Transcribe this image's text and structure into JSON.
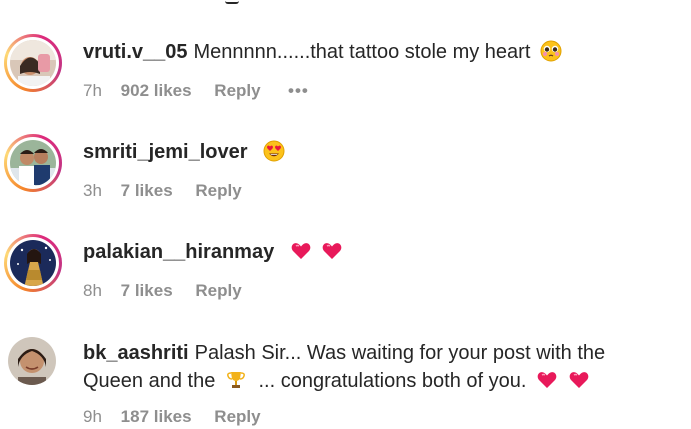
{
  "comments": [
    {
      "username": "vruti.v__05",
      "text": "Mennnnn......that tattoo stole my heart",
      "emoji": "pleading-face",
      "time": "7h",
      "likes": "902 likes",
      "reply": "Reply",
      "more": "•••"
    },
    {
      "username": "smriti_jemi_lover",
      "text": "",
      "emoji": "heart-eyes",
      "time": "3h",
      "likes": "7 likes",
      "reply": "Reply"
    },
    {
      "username": "palakian__hiranmay",
      "text": "",
      "emoji": "two-hearts",
      "time": "8h",
      "likes": "7 likes",
      "reply": "Reply"
    },
    {
      "username": "bk_aashriti",
      "text_line1": "Palash Sir... Was waiting for your post with the",
      "text_line2a": "Queen and the",
      "text_line2b": "... congratulations both of you.",
      "emoji": "trophy, two-hearts",
      "time": "9h",
      "likes": "187 likes",
      "reply": "Reply"
    }
  ]
}
